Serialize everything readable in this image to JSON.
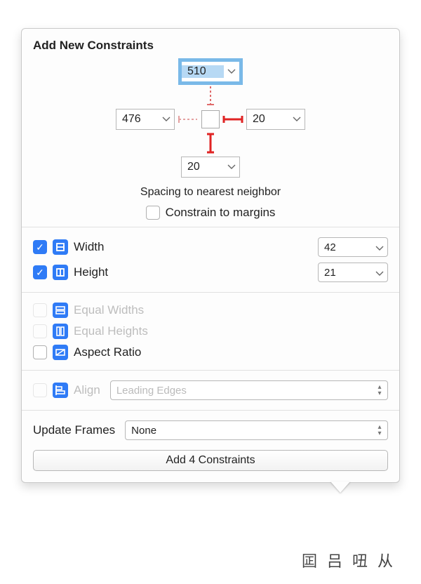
{
  "title": "Add New Constraints",
  "spacing": {
    "top": {
      "value": "510",
      "selected": true,
      "active": false
    },
    "left": {
      "value": "476",
      "selected": false,
      "active": false
    },
    "right": {
      "value": "20",
      "selected": false,
      "active": true
    },
    "bottom": {
      "value": "20",
      "selected": false,
      "active": true
    },
    "caption": "Spacing to nearest neighbor"
  },
  "constrain_to_margins": {
    "label": "Constrain to margins",
    "checked": false
  },
  "size": {
    "width": {
      "label": "Width",
      "checked": true,
      "value": "42"
    },
    "height": {
      "label": "Height",
      "checked": true,
      "value": "21"
    }
  },
  "equal": {
    "widths": {
      "label": "Equal Widths",
      "enabled": false
    },
    "heights": {
      "label": "Equal Heights",
      "enabled": false
    },
    "aspect": {
      "label": "Aspect Ratio",
      "enabled": true
    }
  },
  "align": {
    "label": "Align",
    "enabled": false,
    "selected": "Leading Edges"
  },
  "update_frames": {
    "label": "Update Frames",
    "selected": "None"
  },
  "action_button": "Add 4 Constraints",
  "footer_glyphs": [
    "囸",
    "吕",
    "吜",
    "从"
  ]
}
